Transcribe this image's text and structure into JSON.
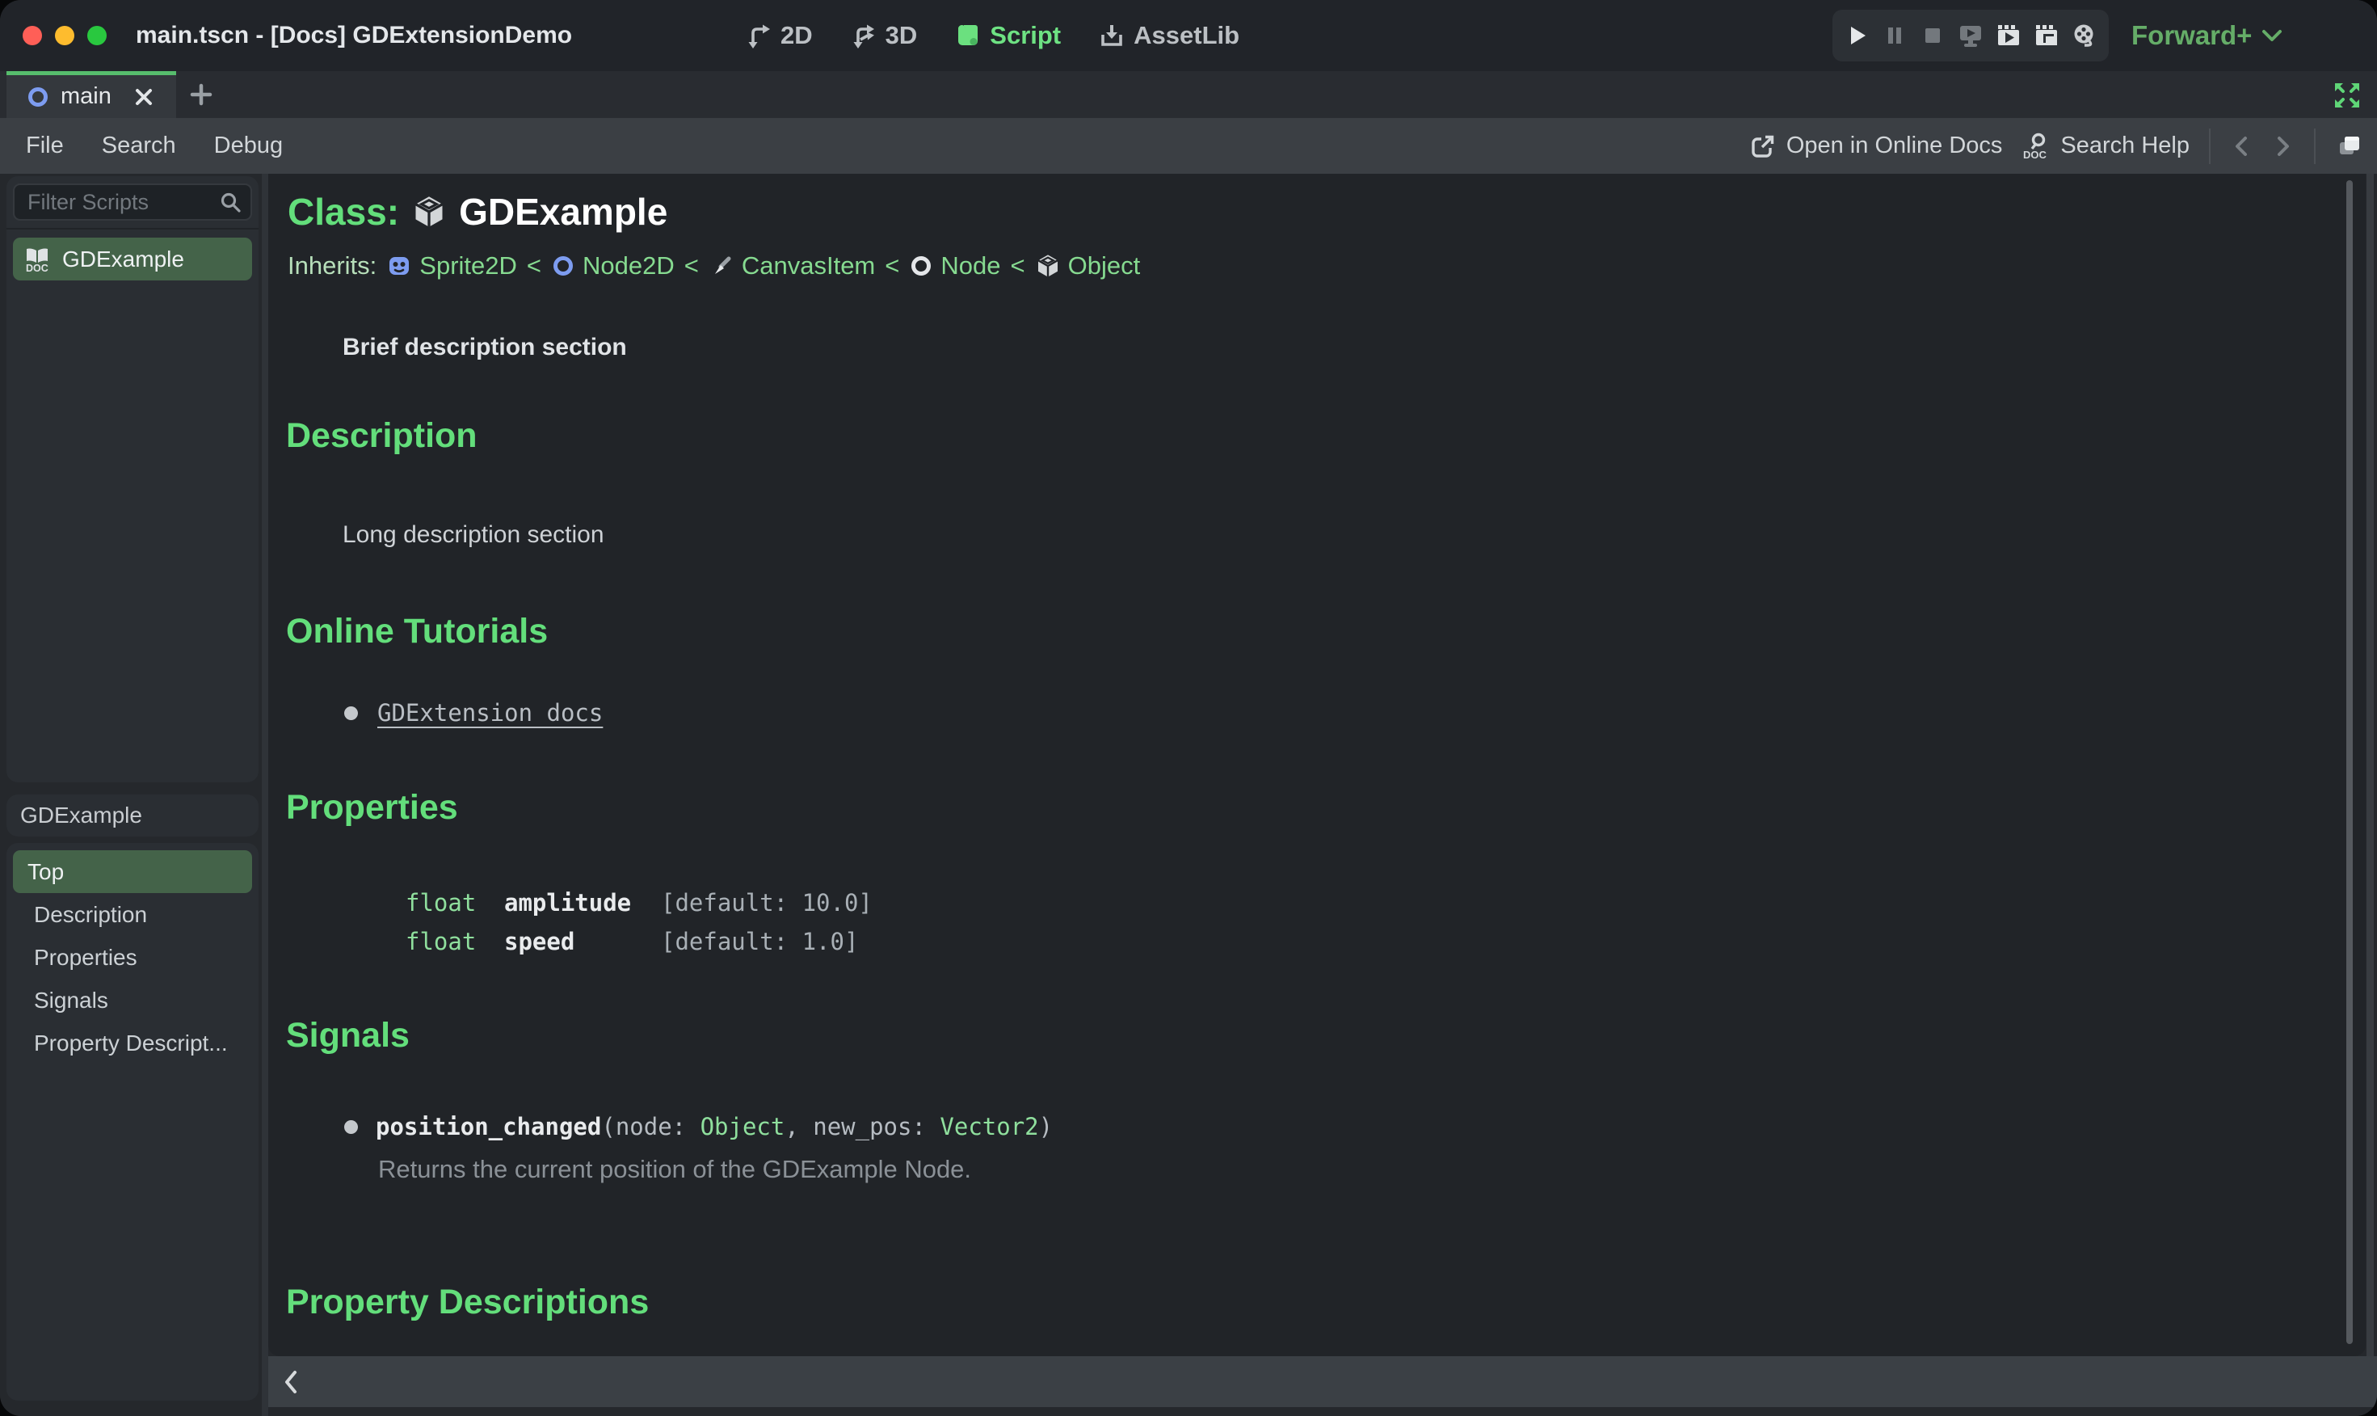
{
  "window": {
    "title": "main.tscn - [Docs] GDExtensionDemo"
  },
  "titlebar": {
    "workspaces": [
      {
        "label": "2D",
        "active": false
      },
      {
        "label": "3D",
        "active": false
      },
      {
        "label": "Script",
        "active": true
      },
      {
        "label": "AssetLib",
        "active": false
      }
    ],
    "playback_icons": [
      "play",
      "pause",
      "stop",
      "play-scene",
      "play-current-scene",
      "play-custom-scene",
      "movie-maker"
    ],
    "renderer": "Forward+"
  },
  "tabs": {
    "items": [
      {
        "label": "main"
      }
    ]
  },
  "menubar": {
    "items": [
      "File",
      "Search",
      "Debug"
    ],
    "online_docs_label": "Open in Online Docs",
    "search_help_label": "Search Help"
  },
  "scripts_panel": {
    "filter_placeholder": "Filter Scripts",
    "items": [
      {
        "label": "GDExample",
        "selected": true
      }
    ]
  },
  "members_panel": {
    "header": "GDExample",
    "items": [
      "Top",
      "Description",
      "Properties",
      "Signals",
      "Property Descript..."
    ],
    "selected_index": 0
  },
  "doc": {
    "class_label": "Class:",
    "class_name": "GDExample",
    "inherits_label": "Inherits:",
    "inherits_separator": "<",
    "inherits": [
      {
        "name": "Sprite2D",
        "icon": "sprite2d-icon"
      },
      {
        "name": "Node2D",
        "icon": "node2d-icon"
      },
      {
        "name": "CanvasItem",
        "icon": "canvasitem-icon"
      },
      {
        "name": "Node",
        "icon": "node-icon"
      },
      {
        "name": "Object",
        "icon": "object-icon"
      }
    ],
    "brief": "Brief description section",
    "sections": {
      "description": {
        "heading": "Description",
        "body": "Long description section"
      },
      "tutorials": {
        "heading": "Online Tutorials",
        "link": "GDExtension docs"
      },
      "properties": {
        "heading": "Properties",
        "rows": [
          {
            "type": "float",
            "name": "amplitude",
            "default": "[default: 10.0]"
          },
          {
            "type": "float",
            "name": "speed",
            "default": "[default: 1.0]"
          }
        ]
      },
      "signals": {
        "heading": "Signals",
        "items": [
          {
            "name": "position_changed",
            "sig_open": "(node: ",
            "type1": "Object",
            "sig_mid": ", new_pos: ",
            "type2": "Vector2",
            "sig_close": ")",
            "description": "Returns the current position of the GDExample Node."
          }
        ]
      },
      "property_descriptions": {
        "heading": "Property Descriptions"
      }
    }
  },
  "colors": {
    "accent_green": "#63de7b",
    "selection_green": "#446349",
    "link_green": "#86da90",
    "code_green": "#8fdf9d",
    "tab_accent": "#57bd6d",
    "node_blue": "#7d9cf0",
    "renderer_green": "#65ad68",
    "traffic_red": "#ff5f57",
    "traffic_yellow": "#febc2e",
    "traffic_green": "#29c83f",
    "doc_bg": "#212428",
    "toolbar_bg": "#3b3f44",
    "panel_bg": "#2a2e33"
  }
}
